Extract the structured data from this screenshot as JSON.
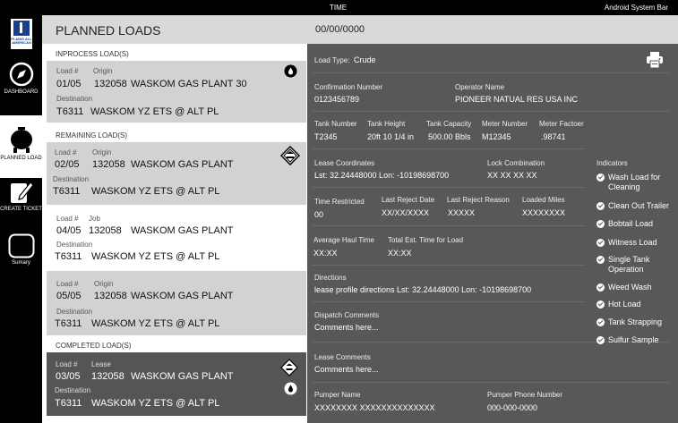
{
  "statusbar": {
    "time": "TIME",
    "system": "Android System Bar"
  },
  "brand": {
    "logo_text": "PLAINS ALL AMERICAN"
  },
  "nav": {
    "dashboard": "DASHBOARD",
    "planned": "PLANNED LOAD",
    "create": "CREATE TICKET",
    "summary": "Sumary"
  },
  "header": {
    "title": "PLANNED LOADS",
    "date": "00/00/0000"
  },
  "sections": {
    "inprocess": "INPROCESS LOAD(S)",
    "remaining": "REMAINING LOAD(S)",
    "completed": "COMPLETED LOAD(S)"
  },
  "loads": [
    {
      "l1": "Load #",
      "l2": "Origin",
      "num": "01/05",
      "code": "132058",
      "origin": "WASKOM GAS PLANT 30",
      "dest_label": "Destination",
      "dest_code": "T6311",
      "dest": "WASKOM YZ ETS @ ALT PL"
    },
    {
      "l1": "Load #",
      "l2": "Origin",
      "num": "02/05",
      "code": "132058",
      "origin": "WASKOM GAS PLANT",
      "dest_label": "Destination",
      "dest_code": "T6311",
      "dest": "WASKOM YZ ETS @ ALT PL"
    },
    {
      "l1": "Load #",
      "l2": "Job",
      "num": "04/05",
      "code": "132058",
      "origin": "WASKOM GAS PLANT",
      "dest_label": "Destination",
      "dest_code": "T6311",
      "dest": "WASKOM YZ ETS @ ALT PL"
    },
    {
      "l1": "Load #",
      "l2": "Origin",
      "num": "05/05",
      "code": "132058",
      "origin": "WASKOM GAS PLANT",
      "dest_label": "Destination",
      "dest_code": "T6311",
      "dest": "WASKOM YZ ETS @ ALT PL"
    },
    {
      "l1": "Load #",
      "l2": "Lease",
      "num": "03/05",
      "code": "132058",
      "origin": "WASKOM GAS PLANT",
      "dest_label": "Destination",
      "dest_code": "T6311",
      "dest": "WASKOM YZ ETS @ ALT PL"
    }
  ],
  "detail": {
    "load_type_label": "Load Type:",
    "load_type": "Crude",
    "confirmation_label": "Confirmation Number",
    "confirmation": "0123456789",
    "operator_label": "Operator Name",
    "operator": "PIONEER NATUAL RES USA INC",
    "tank_number_label": "Tank Number",
    "tank_number": "T2345",
    "tank_height_label": "Tank Height",
    "tank_height": "20ft 10 1/4 in",
    "tank_capacity_label": "Tank Capacity",
    "tank_capacity": "500.00 Bbls",
    "meter_number_label": "Meter Number",
    "meter_number": "M12345",
    "meter_factor_label": "Meter Factoer",
    "meter_factor": ".98741",
    "lease_coords_label": "Lease Coordinates",
    "lease_coords": "Lst: 32.24448000  Lon: -10198698700",
    "lock_combo_label": "Lock Combination",
    "lock_combo": "XX XX XX XX",
    "time_restricted_label": "Time Restricted",
    "time_restricted": "00",
    "last_reject_date_label": "Last Reject Date",
    "last_reject_date": "XX/XX/XXXX",
    "last_reject_reason_label": "Last Reject Reason",
    "last_reject_reason": "XXXXX",
    "loaded_miles_label": "Loaded Miles",
    "loaded_miles": "XXXXXXXX",
    "avg_haul_label": "Average Haul Time",
    "avg_haul": "XX:XX",
    "total_est_label": "Total Est. Time for Load",
    "total_est": "XX:XX",
    "directions_label": "Directions",
    "directions": "lease profile directions Lst: 32.24448000  Lon: -10198698700",
    "dispatch_label": "Dispatch Comments",
    "dispatch": "Comments here...",
    "lease_comments_label": "Lease Comments",
    "lease_comments": "Comments here...",
    "pumper_name_label": "Pumper Name",
    "pumper_name": "XXXXXXXX  XXXXXXXXXXXXXX",
    "pumper_phone_label": "Pumper Phone Number",
    "pumper_phone": "000-000-0000"
  },
  "indicators": {
    "title": "Indicators",
    "items": [
      "Wash Load for Cleaning",
      "Clean Out Trailer",
      "Bobtail Load",
      "Witness Load",
      "Single Tank Operation",
      "Weed Wash",
      "Hot Load",
      "Tank Strapping",
      "Sulfur Sample"
    ]
  }
}
